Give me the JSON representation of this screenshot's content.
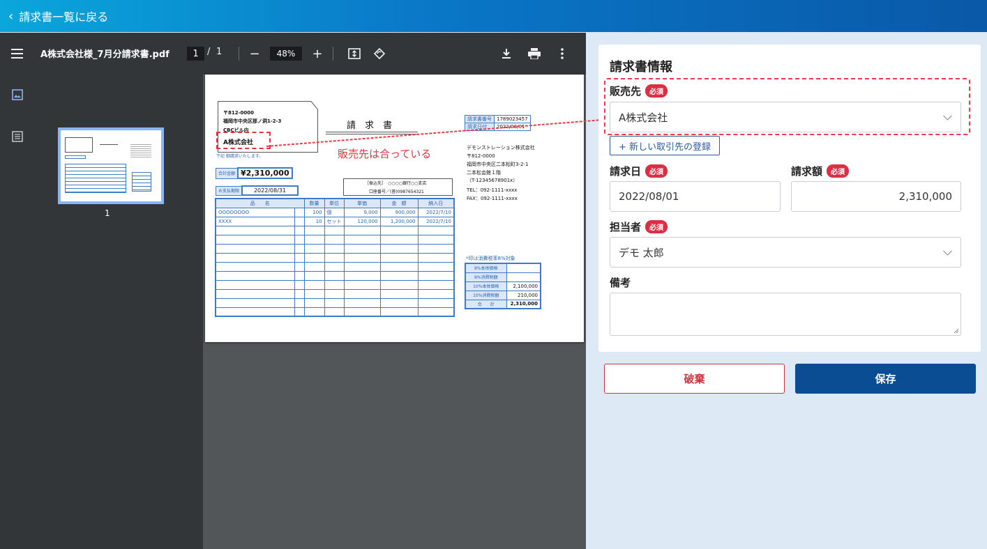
{
  "header": {
    "back_label": "請求書一覧に戻る"
  },
  "viewer": {
    "file_name": "A株式会社様_7月分請求書.pdf",
    "page_current": "1",
    "page_separator": "/",
    "page_total": "1",
    "zoom": "48%",
    "thumbnail_page": "1"
  },
  "invoice": {
    "postal": "〒812-0000",
    "address1": "福岡市中央区那ノ洞1-2-3",
    "address2": "CBCビル内",
    "customer": "A株式会社",
    "greeting": "下記 御請求いたします。",
    "doc_title": "請　求　書",
    "no_label": "請求書番号",
    "no_value": "1789023457",
    "date_label": "請求日付",
    "date_value": "2022/08/01",
    "issuer": [
      "デモンストレーション株式会社",
      "〒812-0000",
      "福岡市中央区二本松町3-2-1",
      "二本松会館１階",
      "（T-12345678901x）",
      "TEL：092-1111-xxxx",
      "FAX：092-1111-xxxx"
    ],
    "total_label": "合計金額",
    "total_value": "¥2,310,000",
    "due_label": "お支払期限",
    "due_value": "2022/08/31",
    "bank_line1": "［振込先］　○○○○銀行○○支店",
    "bank_line2": "口座番号／(普)0987654321",
    "columns": [
      "品　　名",
      "数量",
      "単位",
      "単価",
      "金　額",
      "納入日"
    ],
    "rows": [
      [
        "OOOOOOOO",
        "100",
        "個",
        "9,000",
        "900,000",
        "2022/7/10"
      ],
      [
        "XXXX",
        "10",
        "セット",
        "120,000",
        "1,200,000",
        "2022/7/10"
      ]
    ],
    "tax_note": "*印は消費税率8%対象",
    "summary": [
      [
        "8%本体価格",
        ""
      ],
      [
        "8%消費税額",
        ""
      ],
      [
        "10%本体価格",
        "2,100,000"
      ],
      [
        "10%消費税額",
        "210,000"
      ],
      [
        "合　　計",
        "2,310,000"
      ]
    ],
    "annotation": "販売先は合っている"
  },
  "form": {
    "title": "請求書情報",
    "required_badge": "必須",
    "customer_label": "販売先",
    "customer_value": "A株式会社",
    "new_partner_button": "+ 新しい取引先の登録",
    "date_label": "請求日",
    "date_value": "2022/08/01",
    "amount_label": "請求額",
    "amount_value": "2,310,000",
    "person_label": "担当者",
    "person_value": "デモ 太郎",
    "memo_label": "備考",
    "memo_value": ""
  },
  "actions": {
    "discard": "破棄",
    "save": "保存"
  },
  "colors": {
    "accent": "#0a4d92",
    "danger": "#dc2f42",
    "header_start": "#0aa6dc",
    "header_end": "#0a58a8"
  }
}
